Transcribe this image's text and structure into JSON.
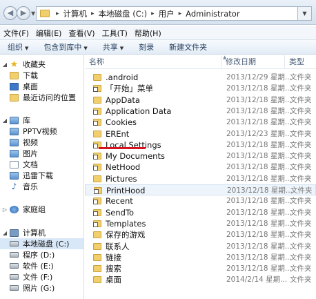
{
  "address": {
    "crumbs": [
      "计算机",
      "本地磁盘 (C:)",
      "用户",
      "Administrator"
    ]
  },
  "menu": [
    "文件(F)",
    "编辑(E)",
    "查看(V)",
    "工具(T)",
    "帮助(H)"
  ],
  "toolbar": [
    {
      "label": "组织",
      "dropdown": true
    },
    {
      "label": "包含到库中",
      "dropdown": true
    },
    {
      "label": "共享",
      "dropdown": true
    },
    {
      "label": "刻录",
      "dropdown": false
    },
    {
      "label": "新建文件夹",
      "dropdown": false
    }
  ],
  "nav": {
    "favorites": "收藏夹",
    "downloads": "下载",
    "desktop": "桌面",
    "recent": "最近访问的位置",
    "libraries": "库",
    "pptv": "PPTV视频",
    "video": "视频",
    "pictures": "图片",
    "documents": "文档",
    "xunlei": "迅雷下载",
    "music": "音乐",
    "homegroup": "家庭组",
    "computer": "计算机",
    "drive_c": "本地磁盘 (C:)",
    "drive_d": "程序 (D:)",
    "drive_e": "软件 (E:)",
    "drive_f": "文件 (F:)",
    "drive_g": "照片 (G:)"
  },
  "columns": {
    "name": "名称",
    "date": "修改日期",
    "type": "类型"
  },
  "files": [
    {
      "name": ".android",
      "date": "2013/12/29 星期...",
      "type": "文件夹",
      "link": false
    },
    {
      "name": "「开始」菜单",
      "date": "2013/12/18 星期...",
      "type": "文件夹",
      "link": true
    },
    {
      "name": "AppData",
      "date": "2013/12/18 星期...",
      "type": "文件夹",
      "link": false
    },
    {
      "name": "Application Data",
      "date": "2013/12/18 星期...",
      "type": "文件夹",
      "link": true
    },
    {
      "name": "Cookies",
      "date": "2013/12/18 星期...",
      "type": "文件夹",
      "link": true
    },
    {
      "name": "EREnt",
      "date": "2013/12/23 星期...",
      "type": "文件夹",
      "link": false
    },
    {
      "name": "Local Settings",
      "date": "2013/12/18 星期...",
      "type": "文件夹",
      "link": true
    },
    {
      "name": "My Documents",
      "date": "2013/12/18 星期...",
      "type": "文件夹",
      "link": true
    },
    {
      "name": "NetHood",
      "date": "2013/12/18 星期...",
      "type": "文件夹",
      "link": true
    },
    {
      "name": "Pictures",
      "date": "2013/12/18 星期...",
      "type": "文件夹",
      "link": false
    },
    {
      "name": "PrintHood",
      "date": "2013/12/18 星期...",
      "type": "文件夹",
      "link": true
    },
    {
      "name": "Recent",
      "date": "2013/12/18 星期...",
      "type": "文件夹",
      "link": true
    },
    {
      "name": "SendTo",
      "date": "2013/12/18 星期...",
      "type": "文件夹",
      "link": true
    },
    {
      "name": "Templates",
      "date": "2013/12/18 星期...",
      "type": "文件夹",
      "link": true
    },
    {
      "name": "保存的游戏",
      "date": "2013/12/18 星期...",
      "type": "文件夹",
      "link": false
    },
    {
      "name": "联系人",
      "date": "2013/12/18 星期...",
      "type": "文件夹",
      "link": false
    },
    {
      "name": "链接",
      "date": "2013/12/18 星期...",
      "type": "文件夹",
      "link": false
    },
    {
      "name": "搜索",
      "date": "2013/12/18 星期...",
      "type": "文件夹",
      "link": false
    },
    {
      "name": "桌面",
      "date": "2014/2/14 星期...",
      "type": "文件夹",
      "link": false
    }
  ]
}
